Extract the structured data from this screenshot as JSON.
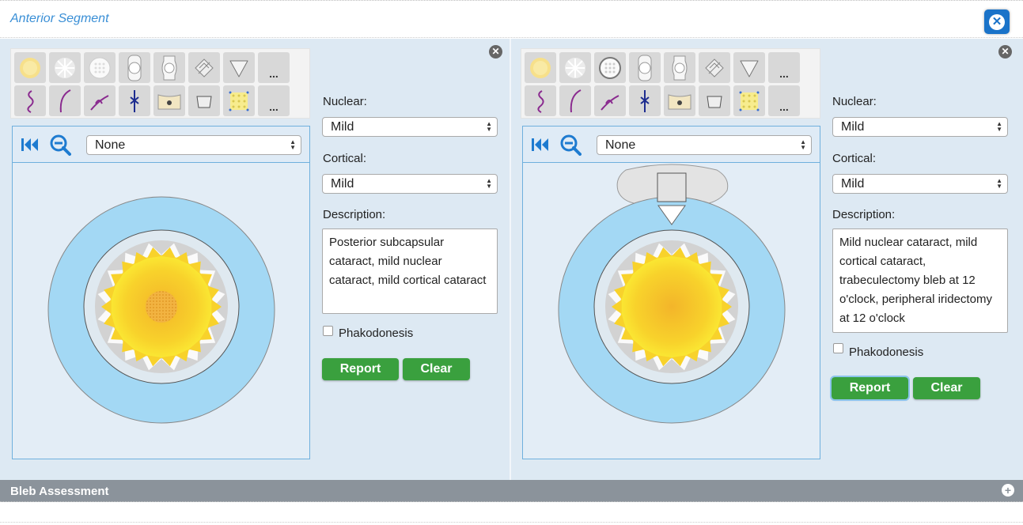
{
  "header": {
    "title": "Anterior Segment",
    "close_icon": "close-icon"
  },
  "left": {
    "tools_row1": [
      "nucleus-icon",
      "cortical-icon",
      "psc-icon",
      "iol-icon",
      "iol-alt-icon",
      "lens-tool-icon",
      "cone-icon",
      "more-icon"
    ],
    "tools_row2": [
      "curve-icon",
      "arc-icon",
      "suture-icon",
      "needle-icon",
      "pi-icon",
      "bleb-icon",
      "grid-icon",
      "more-icon"
    ],
    "more_label": "...",
    "view_select": "None",
    "nuclear_label": "Nuclear:",
    "nuclear_value": "Mild",
    "cortical_label": "Cortical:",
    "cortical_value": "Mild",
    "description_label": "Description:",
    "description": "Posterior subcapsular cataract, mild nuclear cataract, mild cortical cataract",
    "phakodonesis_label": "Phakodonesis",
    "report_label": "Report",
    "clear_label": "Clear"
  },
  "right": {
    "view_select": "None",
    "nuclear_label": "Nuclear:",
    "nuclear_value": "Mild",
    "cortical_label": "Cortical:",
    "cortical_value": "Mild",
    "description_label": "Description:",
    "description": "Mild nuclear cataract, mild cortical cataract, trabeculectomy bleb at 12 o'clock, peripheral iridectomy at 12 o'clock",
    "phakodonesis_label": "Phakodonesis",
    "report_label": "Report",
    "clear_label": "Clear"
  },
  "bleb": {
    "title": "Bleb Assessment"
  },
  "colors": {
    "accent": "#1a73c9",
    "button_green": "#3aa03e",
    "iris_blue": "#a3d8f4",
    "lens_yellow": "#f7c630"
  }
}
